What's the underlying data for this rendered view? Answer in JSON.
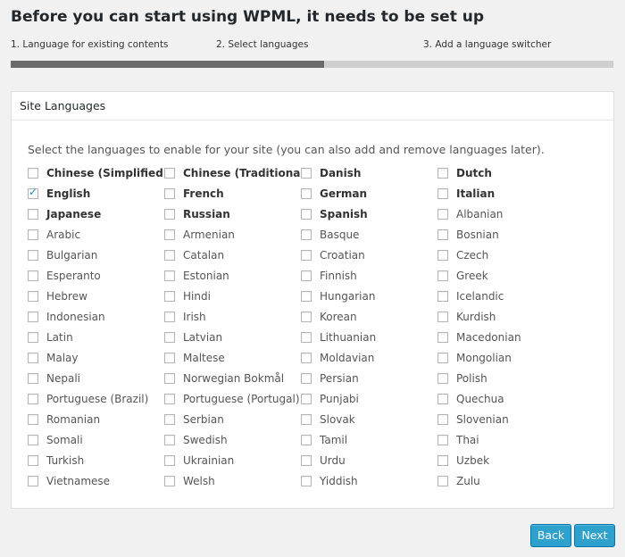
{
  "header": {
    "title": "Before you can start using WPML, it needs to be set up"
  },
  "steps": [
    "1. Language for existing contents",
    "2. Select languages",
    "3. Add a language switcher"
  ],
  "progress": 0.52,
  "panel": {
    "title": "Site Languages",
    "instructions": "Select the languages to enable for your site (you can also add and remove languages later)."
  },
  "languages": [
    {
      "label": "Chinese (Simplified)",
      "bold": true,
      "checked": false
    },
    {
      "label": "Chinese (Traditional)",
      "bold": true,
      "checked": false
    },
    {
      "label": "Danish",
      "bold": true,
      "checked": false
    },
    {
      "label": "Dutch",
      "bold": true,
      "checked": false
    },
    {
      "label": "English",
      "bold": true,
      "checked": true
    },
    {
      "label": "French",
      "bold": true,
      "checked": false
    },
    {
      "label": "German",
      "bold": true,
      "checked": false
    },
    {
      "label": "Italian",
      "bold": true,
      "checked": false
    },
    {
      "label": "Japanese",
      "bold": true,
      "checked": false
    },
    {
      "label": "Russian",
      "bold": true,
      "checked": false
    },
    {
      "label": "Spanish",
      "bold": true,
      "checked": false
    },
    {
      "label": "Albanian",
      "bold": false,
      "checked": false
    },
    {
      "label": "Arabic",
      "bold": false,
      "checked": false
    },
    {
      "label": "Armenian",
      "bold": false,
      "checked": false
    },
    {
      "label": "Basque",
      "bold": false,
      "checked": false
    },
    {
      "label": "Bosnian",
      "bold": false,
      "checked": false
    },
    {
      "label": "Bulgarian",
      "bold": false,
      "checked": false
    },
    {
      "label": "Catalan",
      "bold": false,
      "checked": false
    },
    {
      "label": "Croatian",
      "bold": false,
      "checked": false
    },
    {
      "label": "Czech",
      "bold": false,
      "checked": false
    },
    {
      "label": "Esperanto",
      "bold": false,
      "checked": false
    },
    {
      "label": "Estonian",
      "bold": false,
      "checked": false
    },
    {
      "label": "Finnish",
      "bold": false,
      "checked": false
    },
    {
      "label": "Greek",
      "bold": false,
      "checked": false
    },
    {
      "label": "Hebrew",
      "bold": false,
      "checked": false
    },
    {
      "label": "Hindi",
      "bold": false,
      "checked": false
    },
    {
      "label": "Hungarian",
      "bold": false,
      "checked": false
    },
    {
      "label": "Icelandic",
      "bold": false,
      "checked": false
    },
    {
      "label": "Indonesian",
      "bold": false,
      "checked": false
    },
    {
      "label": "Irish",
      "bold": false,
      "checked": false
    },
    {
      "label": "Korean",
      "bold": false,
      "checked": false
    },
    {
      "label": "Kurdish",
      "bold": false,
      "checked": false
    },
    {
      "label": "Latin",
      "bold": false,
      "checked": false
    },
    {
      "label": "Latvian",
      "bold": false,
      "checked": false
    },
    {
      "label": "Lithuanian",
      "bold": false,
      "checked": false
    },
    {
      "label": "Macedonian",
      "bold": false,
      "checked": false
    },
    {
      "label": "Malay",
      "bold": false,
      "checked": false
    },
    {
      "label": "Maltese",
      "bold": false,
      "checked": false
    },
    {
      "label": "Moldavian",
      "bold": false,
      "checked": false
    },
    {
      "label": "Mongolian",
      "bold": false,
      "checked": false
    },
    {
      "label": "Nepali",
      "bold": false,
      "checked": false
    },
    {
      "label": "Norwegian Bokmål",
      "bold": false,
      "checked": false
    },
    {
      "label": "Persian",
      "bold": false,
      "checked": false
    },
    {
      "label": "Polish",
      "bold": false,
      "checked": false
    },
    {
      "label": "Portuguese (Brazil)",
      "bold": false,
      "checked": false
    },
    {
      "label": "Portuguese (Portugal)",
      "bold": false,
      "checked": false
    },
    {
      "label": "Punjabi",
      "bold": false,
      "checked": false
    },
    {
      "label": "Quechua",
      "bold": false,
      "checked": false
    },
    {
      "label": "Romanian",
      "bold": false,
      "checked": false
    },
    {
      "label": "Serbian",
      "bold": false,
      "checked": false
    },
    {
      "label": "Slovak",
      "bold": false,
      "checked": false
    },
    {
      "label": "Slovenian",
      "bold": false,
      "checked": false
    },
    {
      "label": "Somali",
      "bold": false,
      "checked": false
    },
    {
      "label": "Swedish",
      "bold": false,
      "checked": false
    },
    {
      "label": "Tamil",
      "bold": false,
      "checked": false
    },
    {
      "label": "Thai",
      "bold": false,
      "checked": false
    },
    {
      "label": "Turkish",
      "bold": false,
      "checked": false
    },
    {
      "label": "Ukrainian",
      "bold": false,
      "checked": false
    },
    {
      "label": "Urdu",
      "bold": false,
      "checked": false
    },
    {
      "label": "Uzbek",
      "bold": false,
      "checked": false
    },
    {
      "label": "Vietnamese",
      "bold": false,
      "checked": false
    },
    {
      "label": "Welsh",
      "bold": false,
      "checked": false
    },
    {
      "label": "Yiddish",
      "bold": false,
      "checked": false
    },
    {
      "label": "Zulu",
      "bold": false,
      "checked": false
    }
  ],
  "buttons": {
    "back_label": "Back",
    "next_label": "Next"
  },
  "colors": {
    "primary_button": "#2ea2cc",
    "progress_fill": "#6b6b6b",
    "progress_track": "#cfcfcf"
  }
}
